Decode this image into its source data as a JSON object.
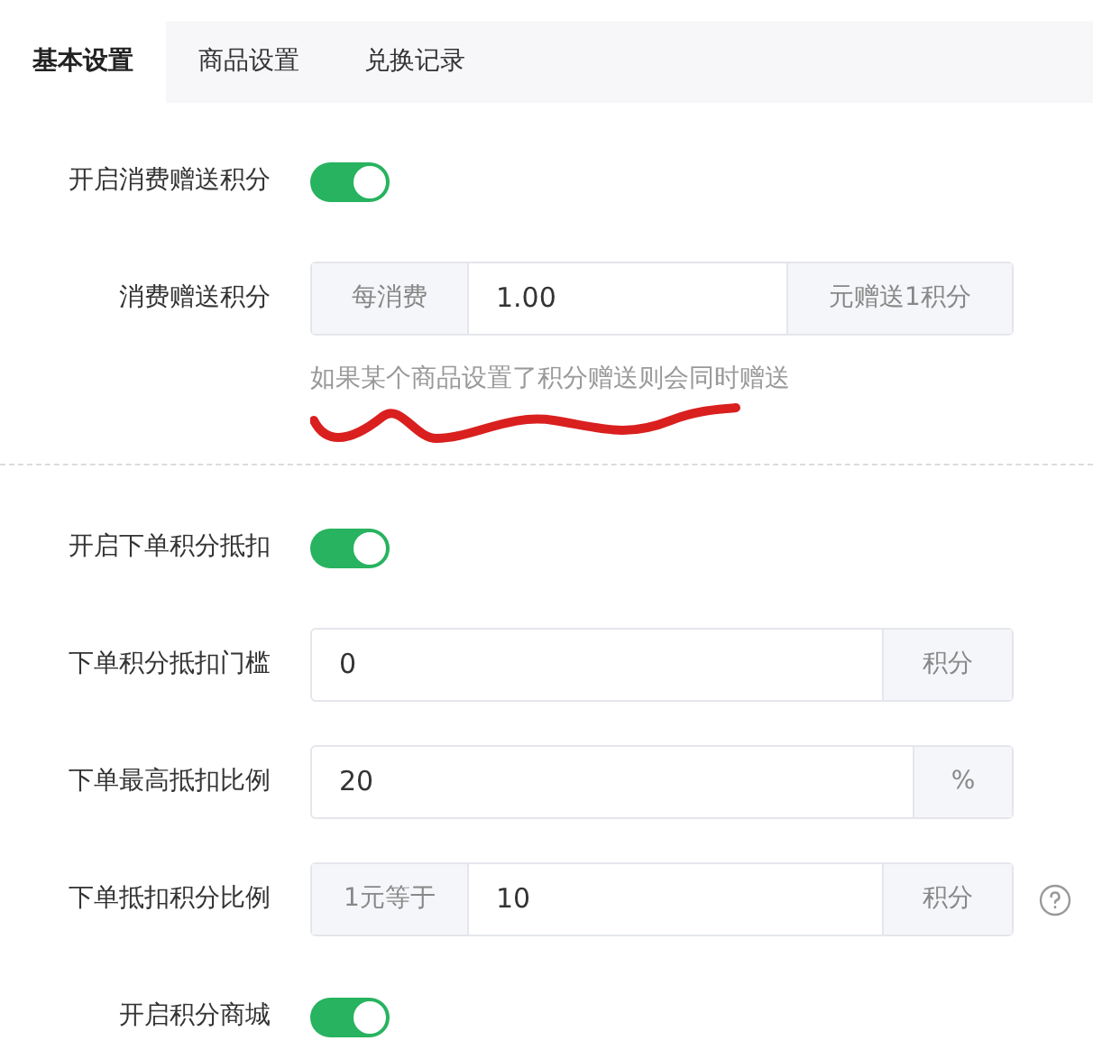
{
  "tabs": [
    {
      "label": "基本设置",
      "selected": true
    },
    {
      "label": "商品设置",
      "selected": false
    },
    {
      "label": "兑换记录",
      "selected": false
    }
  ],
  "sections": [
    {
      "rows": [
        {
          "kind": "toggle",
          "label": "开启消费赠送积分",
          "on": true
        },
        {
          "kind": "field",
          "label": "消费赠送积分",
          "prefix": "每消费",
          "value": "1.00",
          "suffix": "元赠送1积分",
          "hint": "如果某个商品设置了积分赠送则会同时赠送",
          "help": false
        }
      ]
    },
    {
      "rows": [
        {
          "kind": "toggle",
          "label": "开启下单积分抵扣",
          "on": true
        },
        {
          "kind": "field",
          "label": "下单积分抵扣门槛",
          "value": "0",
          "suffix": "积分",
          "help": false
        },
        {
          "kind": "field",
          "label": "下单最高抵扣比例",
          "value": "20",
          "suffix": "%",
          "help": false
        },
        {
          "kind": "field",
          "label": "下单抵扣积分比例",
          "prefix": "1元等于",
          "value": "10",
          "suffix": "积分",
          "help": true
        },
        {
          "kind": "toggle",
          "label": "开启积分商城",
          "on": true
        }
      ]
    }
  ]
}
